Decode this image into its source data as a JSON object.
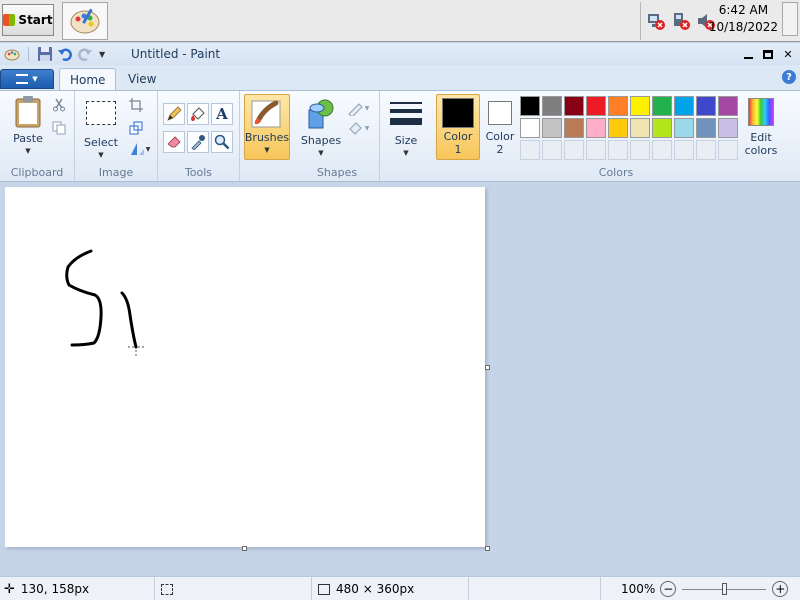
{
  "taskbar": {
    "start_label": "Start",
    "app_icon": "paint-palette-icon",
    "time": "6:42 AM",
    "date": "10/18/2022",
    "tray_icons": [
      "network-error-icon",
      "network-error-icon",
      "volume-mute-icon"
    ]
  },
  "window": {
    "title": "Untitled - Paint"
  },
  "tabs": {
    "home": "Home",
    "view": "View"
  },
  "ribbon": {
    "clipboard": {
      "paste": "Paste",
      "group": "Clipboard"
    },
    "image": {
      "select": "Select",
      "group": "Image"
    },
    "tools": {
      "group": "Tools"
    },
    "brushes": {
      "label": "Brushes"
    },
    "shapes": {
      "label": "Shapes",
      "group": "Shapes"
    },
    "size": {
      "label": "Size"
    },
    "colors": {
      "color1_line1": "Color",
      "color1_line2": "1",
      "color2_line1": "Color",
      "color2_line2": "2",
      "edit_line1": "Edit",
      "edit_line2": "colors",
      "group": "Colors",
      "color1": "#000000",
      "color2": "#ffffff",
      "palette_row1": [
        "#000000",
        "#7f7f7f",
        "#880015",
        "#ed1c24",
        "#ff7f27",
        "#fff200",
        "#22b14c",
        "#00a2e8",
        "#3f48cc",
        "#a349a4"
      ],
      "palette_row2": [
        "#ffffff",
        "#c3c3c3",
        "#b97a57",
        "#ffaec9",
        "#ffc90e",
        "#efe4b0",
        "#b5e61d",
        "#99d9ea",
        "#7092be",
        "#c8bfe7"
      ]
    }
  },
  "status": {
    "cursor_pos": "130, 158px",
    "canvas_size": "480 × 360px",
    "zoom": "100%",
    "zoom_minus": "−",
    "zoom_plus": "+"
  }
}
